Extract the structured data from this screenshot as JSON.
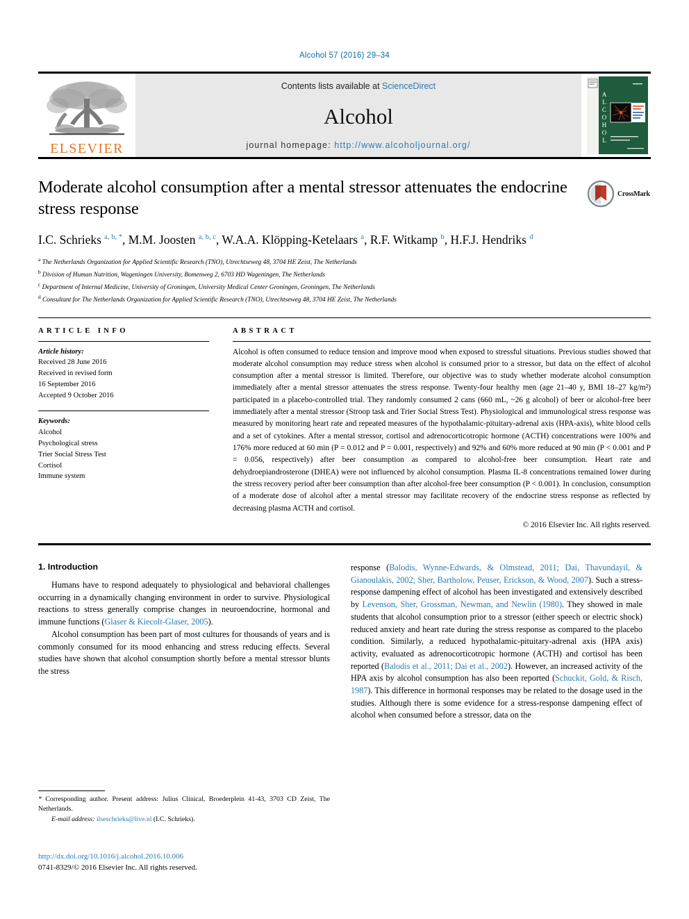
{
  "running_head": "Alcohol 57 (2016) 29–34",
  "masthead": {
    "publisher_name": "ELSEVIER",
    "contents_prefix": "Contents lists available at ",
    "contents_link": "ScienceDirect",
    "journal_name": "Alcohol",
    "homepage_prefix": "journal homepage: ",
    "homepage_url": "http://www.alcoholjournal.org/",
    "cover_title": "ALCOHOL"
  },
  "title": "Moderate alcohol consumption after a mental stressor attenuates the endocrine stress response",
  "crossmark_label": "CrossMark",
  "authors_html": "I.C. Schrieks <sup>a, b, *</sup>, M.M. Joosten <sup>a, b, c</sup>, W.A.A. Klöpping-Ketelaars <sup>a</sup>, R.F. Witkamp <sup>b</sup>, H.F.J. Hendriks <sup>d</sup>",
  "affiliations": [
    {
      "mark": "a",
      "text": "The Netherlands Organization for Applied Scientific Research (TNO), Utrechtseweg 48, 3704 HE Zeist, The Netherlands"
    },
    {
      "mark": "b",
      "text": "Division of Human Nutrition, Wageningen University, Bomenweg 2, 6703 HD Wageningen, The Netherlands"
    },
    {
      "mark": "c",
      "text": "Department of Internal Medicine, University of Groningen, University Medical Center Groningen, Groningen, The Netherlands"
    },
    {
      "mark": "d",
      "text": "Consultant for The Netherlands Organization for Applied Scientific Research (TNO), Utrechtseweg 48, 3704 HE Zeist, The Netherlands"
    }
  ],
  "article_info": {
    "heading": "ARTICLE INFO",
    "history_label": "Article history:",
    "history_lines": [
      "Received 28 June 2016",
      "Received in revised form",
      "16 September 2016",
      "Accepted 9 October 2016"
    ],
    "keywords_label": "Keywords:",
    "keywords": [
      "Alcohol",
      "Psychological stress",
      "Trier Social Stress Test",
      "Cortisol",
      "Immune system"
    ]
  },
  "abstract": {
    "heading": "ABSTRACT",
    "text": "Alcohol is often consumed to reduce tension and improve mood when exposed to stressful situations. Previous studies showed that moderate alcohol consumption may reduce stress when alcohol is consumed prior to a stressor, but data on the effect of alcohol consumption after a mental stressor is limited. Therefore, our objective was to study whether moderate alcohol consumption immediately after a mental stressor attenuates the stress response. Twenty-four healthy men (age 21–40 y, BMI 18–27 kg/m²) participated in a placebo-controlled trial. They randomly consumed 2 cans (660 mL, ~26 g alcohol) of beer or alcohol-free beer immediately after a mental stressor (Stroop task and Trier Social Stress Test). Physiological and immunological stress response was measured by monitoring heart rate and repeated measures of the hypothalamic-pituitary-adrenal axis (HPA-axis), white blood cells and a set of cytokines. After a mental stressor, cortisol and adrenocorticotropic hormone (ACTH) concentrations were 100% and 176% more reduced at 60 min (P = 0.012 and P = 0.001, respectively) and 92% and 60% more reduced at 90 min (P < 0.001 and P = 0.056, respectively) after beer consumption as compared to alcohol-free beer consumption. Heart rate and dehydroepiandrosterone (DHEA) were not influenced by alcohol consumption. Plasma IL-8 concentrations remained lower during the stress recovery period after beer consumption than after alcohol-free beer consumption (P < 0.001). In conclusion, consumption of a moderate dose of alcohol after a mental stressor may facilitate recovery of the endocrine stress response as reflected by decreasing plasma ACTH and cortisol.",
    "copyright": "© 2016 Elsevier Inc. All rights reserved."
  },
  "introduction": {
    "section_number_title": "1. Introduction",
    "left_paragraphs_html": [
      "Humans have to respond adequately to physiological and behavioral challenges occurring in a dynamically changing environment in order to survive. Physiological reactions to stress generally comprise changes in neuroendocrine, hormonal and immune functions (<span class=\"cit\">Glaser &amp; Kiecolt-Glaser, 2005</span>).",
      "Alcohol consumption has been part of most cultures for thousands of years and is commonly consumed for its mood enhancing and stress reducing effects. Several studies have shown that alcohol consumption shortly before a mental stressor blunts the stress"
    ],
    "right_paragraphs_html": [
      "response (<span class=\"cit\">Balodis, Wynne-Edwards, &amp; Olmstead, 2011; Dai, Thavundayil, &amp; Gianoulakis, 2002; Sher, Bartholow, Peuser, Erickson, &amp; Wood, 2007</span>). Such a stress-response dampening effect of alcohol has been investigated and extensively described by <span class=\"cit\">Levenson, Sher, Grossman, Newman, and Newlin (1980)</span>. They showed in male students that alcohol consumption prior to a stressor (either speech or electric shock) reduced anxiety and heart rate during the stress response as compared to the placebo condition. Similarly, a reduced hypothalamic-pituitary-adrenal axis (HPA axis) activity, evaluated as adrenocorticotropic hormone (ACTH) and cortisol has been reported (<span class=\"cit\">Balodis et al., 2011; Dai et al., 2002</span>). However, an increased activity of the HPA axis by alcohol consumption has also been reported (<span class=\"cit\">Schuckit, Gold, &amp; Risch, 1987</span>). This difference in hormonal responses may be related to the dosage used in the studies. Although there is some evidence for a stress-response dampening effect of alcohol when consumed before a stressor, data on the"
    ]
  },
  "footnote": {
    "corresponding_html": "<span class=\"ital\">*</span> Corresponding author. Present address: Julius Clinical, Broederplein 41-43, 3703 CD Zeist, The Netherlands.",
    "email_label": "E-mail address:",
    "email": "ilseschrieks@live.nl",
    "email_suffix": "(I.C. Schrieks)."
  },
  "footer": {
    "doi": "http://dx.doi.org/10.1016/j.alcohol.2016.10.006",
    "issn_line": "0741-8329/© 2016 Elsevier Inc. All rights reserved."
  },
  "colors": {
    "link_blue": "#2a7ab0",
    "elsevier_orange": "#e87722",
    "cover_green": "#1f5c3d",
    "crossmark_red": "#c0392b"
  }
}
